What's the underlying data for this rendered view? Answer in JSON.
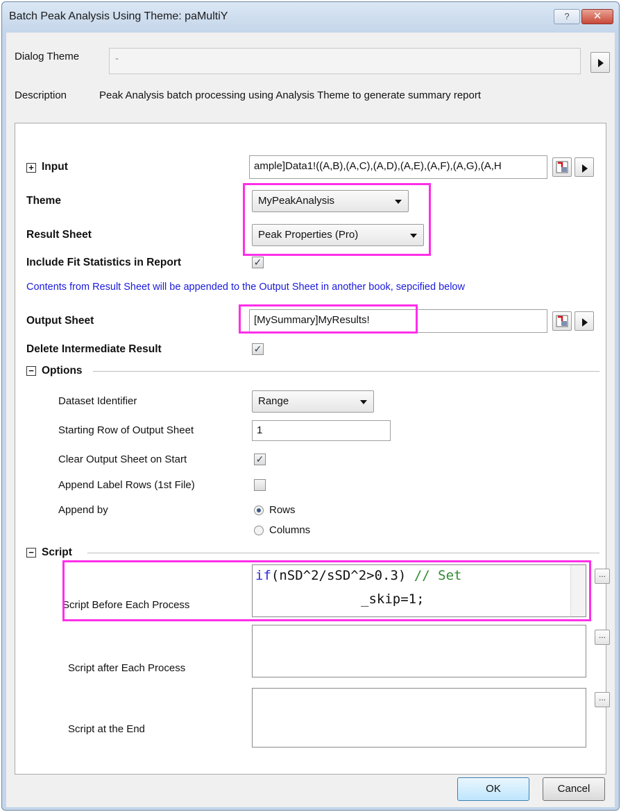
{
  "window": {
    "title": "Batch Peak Analysis Using Theme: paMultiY",
    "help_label": "?",
    "close_label": "✕"
  },
  "dialog_theme": {
    "label": "Dialog Theme",
    "value": "-"
  },
  "description": {
    "label": "Description",
    "text": "Peak Analysis batch processing using Analysis Theme to generate summary report"
  },
  "input": {
    "label": "Input",
    "value": "ample]Data1!((A,B),(A,C),(A,D),(A,E),(A,F),(A,G),(A,H"
  },
  "theme": {
    "label": "Theme",
    "selected": "MyPeakAnalysis"
  },
  "result_sheet": {
    "label": "Result Sheet",
    "selected": "Peak Properties (Pro)"
  },
  "include_fit_stats": {
    "label": "Include Fit Statistics in Report",
    "checked": true
  },
  "note": {
    "text": "Contents from Result Sheet will be appended to the Output Sheet in another book, sepcified below",
    "color": "#1a1adb"
  },
  "output_sheet": {
    "label": "Output Sheet",
    "value": "[MySummary]MyResults!"
  },
  "delete_intermediate": {
    "label": "Delete Intermediate Result",
    "checked": true
  },
  "options": {
    "label": "Options",
    "dataset_identifier": {
      "label": "Dataset Identifier",
      "selected": "Range"
    },
    "starting_row": {
      "label": "Starting Row of Output Sheet",
      "value": "1"
    },
    "clear_output": {
      "label": "Clear Output Sheet on Start",
      "checked": true
    },
    "append_label_rows": {
      "label": "Append Label Rows (1st File)",
      "checked": false
    },
    "append_by": {
      "label": "Append by",
      "options": [
        "Rows",
        "Columns"
      ],
      "selected": "Rows"
    }
  },
  "script": {
    "label": "Script",
    "before": {
      "label": "Script Before Each Process",
      "code_keyword": "if",
      "code_expr": "(nSD^2/sSD^2>0.3)",
      "code_comment": "// Set",
      "code_line2": "_skip=1;"
    },
    "after": {
      "label": "Script after Each Process"
    },
    "end": {
      "label": "Script at the End"
    },
    "ellipsis_label": "..."
  },
  "buttons": {
    "ok": "OK",
    "cancel": "Cancel"
  },
  "colors": {
    "highlight": "#ff2ee8",
    "title_bar": "#c5d6ea",
    "close": "#c8493a"
  }
}
